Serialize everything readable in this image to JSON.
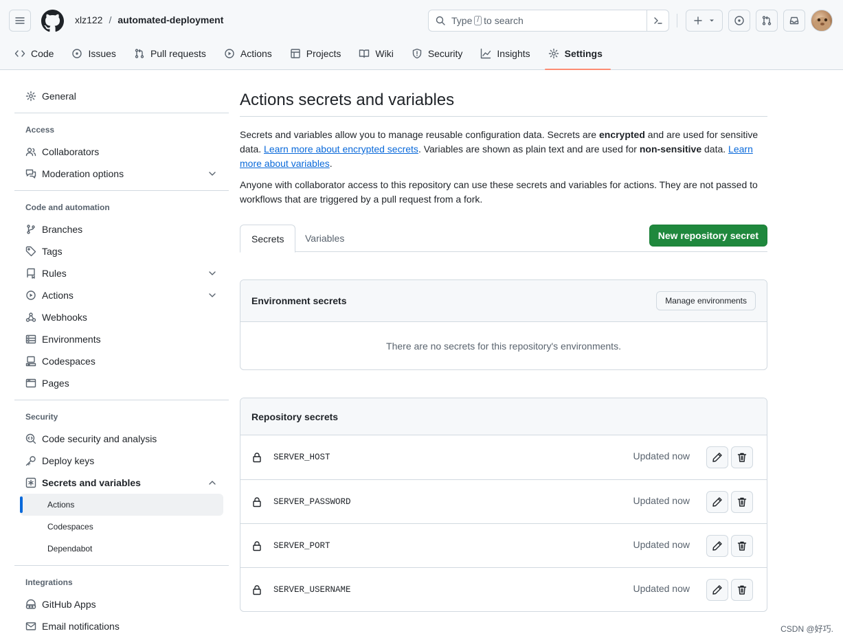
{
  "header": {
    "owner": "xlz122",
    "separator": "/",
    "repo": "automated-deployment",
    "search_pre": "Type",
    "search_key": "/",
    "search_post": "to search"
  },
  "repo_tabs": [
    {
      "label": "Code",
      "icon": "code-icon"
    },
    {
      "label": "Issues",
      "icon": "issue-icon"
    },
    {
      "label": "Pull requests",
      "icon": "pull-request-icon"
    },
    {
      "label": "Actions",
      "icon": "play-icon"
    },
    {
      "label": "Projects",
      "icon": "table-icon"
    },
    {
      "label": "Wiki",
      "icon": "book-icon"
    },
    {
      "label": "Security",
      "icon": "shield-icon"
    },
    {
      "label": "Insights",
      "icon": "graph-icon"
    },
    {
      "label": "Settings",
      "icon": "gear-icon",
      "selected": true
    }
  ],
  "sidebar": {
    "general": "General",
    "access_heading": "Access",
    "collaborators": "Collaborators",
    "moderation": "Moderation options",
    "code_heading": "Code and automation",
    "branches": "Branches",
    "tags": "Tags",
    "rules": "Rules",
    "actions": "Actions",
    "webhooks": "Webhooks",
    "environments": "Environments",
    "codespaces": "Codespaces",
    "pages": "Pages",
    "security_heading": "Security",
    "code_security": "Code security and analysis",
    "deploy_keys": "Deploy keys",
    "secrets_vars": "Secrets and variables",
    "sub_actions": "Actions",
    "sub_codespaces": "Codespaces",
    "sub_dependabot": "Dependabot",
    "integrations_heading": "Integrations",
    "github_apps": "GitHub Apps",
    "email_notifications": "Email notifications"
  },
  "main": {
    "title": "Actions secrets and variables",
    "desc1_a": "Secrets and variables allow you to manage reusable configuration data. Secrets are ",
    "desc1_b": "encrypted",
    "desc1_c": " and are used for sensitive data. ",
    "desc1_link1": "Learn more about encrypted secrets",
    "desc1_d": ". Variables are shown as plain text and are used for ",
    "desc1_e": "non-sensitive",
    "desc1_f": " data. ",
    "desc1_link2": "Learn more about variables",
    "desc1_g": ".",
    "desc2": "Anyone with collaborator access to this repository can use these secrets and variables for actions. They are not passed to workflows that are triggered by a pull request from a fork.",
    "tab_secrets": "Secrets",
    "tab_variables": "Variables",
    "new_secret": "New repository secret",
    "env_heading": "Environment secrets",
    "manage_env": "Manage environments",
    "env_empty": "There are no secrets for this repository's environments.",
    "repo_heading": "Repository secrets",
    "secrets": [
      {
        "name": "SERVER_HOST",
        "updated": "Updated now"
      },
      {
        "name": "SERVER_PASSWORD",
        "updated": "Updated now"
      },
      {
        "name": "SERVER_PORT",
        "updated": "Updated now"
      },
      {
        "name": "SERVER_USERNAME",
        "updated": "Updated now"
      }
    ]
  },
  "watermark": "CSDN @好巧.",
  "colors": {
    "accent": "#1f883d",
    "link": "#0969da",
    "tab_underline": "#fd8c73"
  }
}
